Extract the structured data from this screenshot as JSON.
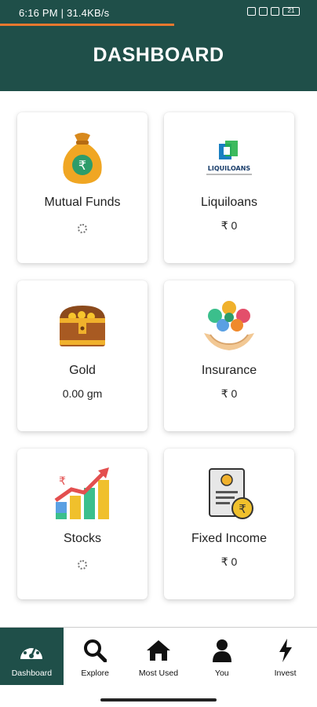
{
  "statusbar": {
    "left_text": "6:16 PM | 31.4KB/s",
    "battery": "21"
  },
  "header": {
    "title": "DASHBOARD"
  },
  "cards": [
    {
      "title": "Mutual Funds",
      "value": "",
      "icon": "money-bag-icon",
      "loading": true
    },
    {
      "title": "Liquiloans",
      "value": "₹ 0",
      "icon": "liquiloans-logo",
      "logo_text": "LIQUILOANS"
    },
    {
      "title": "Gold",
      "value": "0.00 gm",
      "icon": "treasure-chest-icon"
    },
    {
      "title": "Insurance",
      "value": "₹ 0",
      "icon": "insurance-hands-icon"
    },
    {
      "title": "Stocks",
      "value": "",
      "icon": "stocks-chart-icon",
      "loading": true
    },
    {
      "title": "Fixed Income",
      "value": "₹ 0",
      "icon": "certificate-icon"
    }
  ],
  "nav": [
    {
      "label": "Dashboard",
      "icon": "speedometer-icon",
      "active": true
    },
    {
      "label": "Explore",
      "icon": "search-icon"
    },
    {
      "label": "Most Used",
      "icon": "home-icon"
    },
    {
      "label": "You",
      "icon": "user-icon"
    },
    {
      "label": "Invest",
      "icon": "lightning-icon"
    }
  ],
  "colors": {
    "primary": "#1f4f49",
    "progress": "#e8782e"
  }
}
